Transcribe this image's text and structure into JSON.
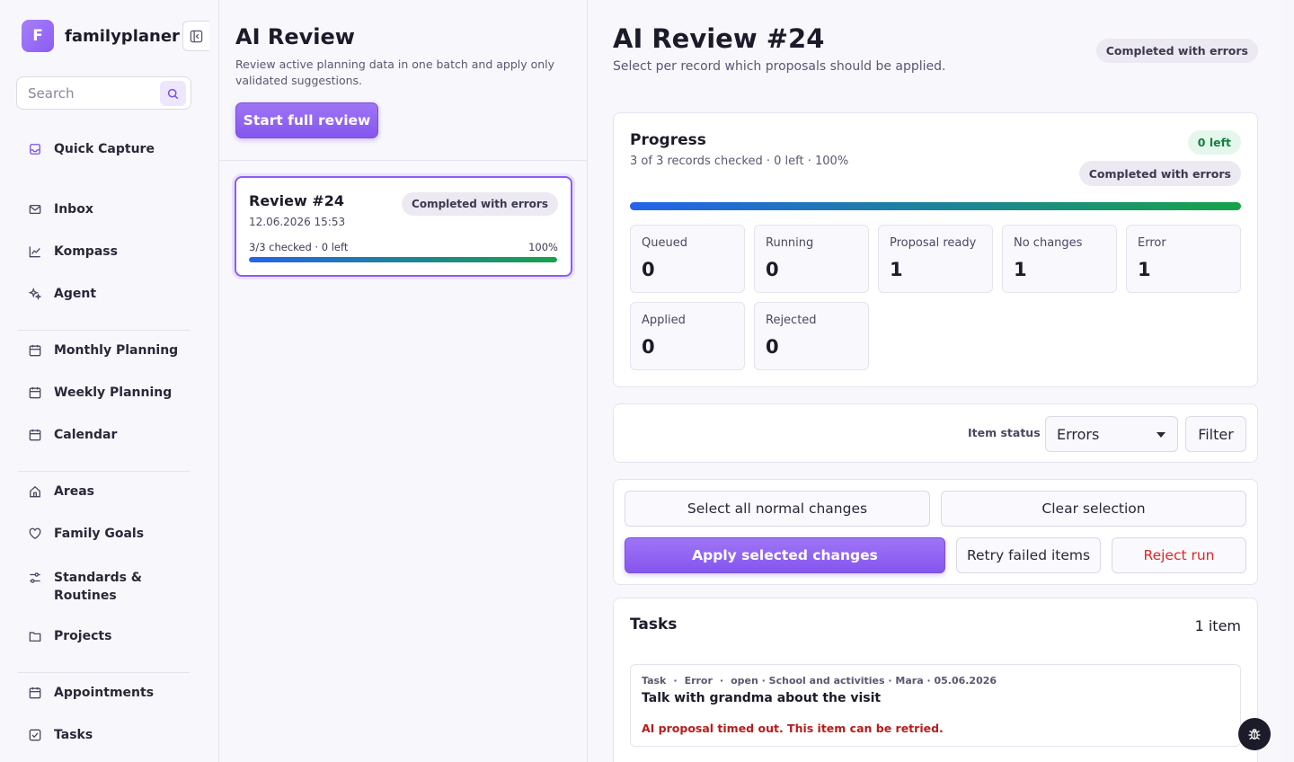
{
  "app": {
    "initial": "F",
    "name": "familyplaner"
  },
  "search": {
    "placeholder": "Search"
  },
  "sidebar": {
    "items": [
      {
        "label": "Quick Capture"
      },
      {
        "label": "Inbox"
      },
      {
        "label": "Kompass"
      },
      {
        "label": "Agent"
      },
      {
        "label": "Monthly Planning"
      },
      {
        "label": "Weekly Planning"
      },
      {
        "label": "Calendar"
      },
      {
        "label": "Areas"
      },
      {
        "label": "Family Goals"
      },
      {
        "label": "Standards &",
        "label2": "Routines"
      },
      {
        "label": "Projects"
      },
      {
        "label": "Appointments"
      },
      {
        "label": "Tasks"
      }
    ]
  },
  "review_list": {
    "title": "AI Review",
    "subtitle": "Review active planning data in one batch and apply only validated suggestions.",
    "start_button": "Start full review",
    "reviews": [
      {
        "title": "Review #24",
        "date": "12.06.2026 15:53",
        "status": "Completed with errors",
        "checked": "3/3 checked · 0 left",
        "percent": "100%",
        "progress": 1.0
      }
    ]
  },
  "detail": {
    "title": "AI Review #24",
    "subtitle": "Select per record which proposals should be applied.",
    "status": "Completed with errors",
    "progress": {
      "title": "Progress",
      "summary": "3 of 3 records checked · 0 left · 100%",
      "left_badge": "0 left",
      "status": "Completed with errors",
      "fraction": 1.0,
      "stats": [
        {
          "label": "Queued",
          "value": "0"
        },
        {
          "label": "Running",
          "value": "0"
        },
        {
          "label": "Proposal ready",
          "value": "1"
        },
        {
          "label": "No changes",
          "value": "1"
        },
        {
          "label": "Error",
          "value": "1"
        },
        {
          "label": "Applied",
          "value": "0"
        },
        {
          "label": "Rejected",
          "value": "0"
        }
      ]
    },
    "filter": {
      "label": "Item status",
      "selected": "Errors",
      "button": "Filter"
    },
    "actions": {
      "select_all": "Select all normal changes",
      "clear": "Clear selection",
      "apply": "Apply selected changes",
      "retry": "Retry failed items",
      "reject": "Reject run"
    },
    "tasks": {
      "title": "Tasks",
      "count": "1 item",
      "items": [
        {
          "type": "Task",
          "status": "Error",
          "meta": "open · School and activities · Mara · 05.06.2026",
          "title": "Talk with grandma about the visit",
          "error": "AI proposal timed out. This item can be retried."
        }
      ]
    }
  },
  "colors": {
    "accent": "#8b5cf6",
    "error": "#b91c1c",
    "success": "#15803d"
  }
}
